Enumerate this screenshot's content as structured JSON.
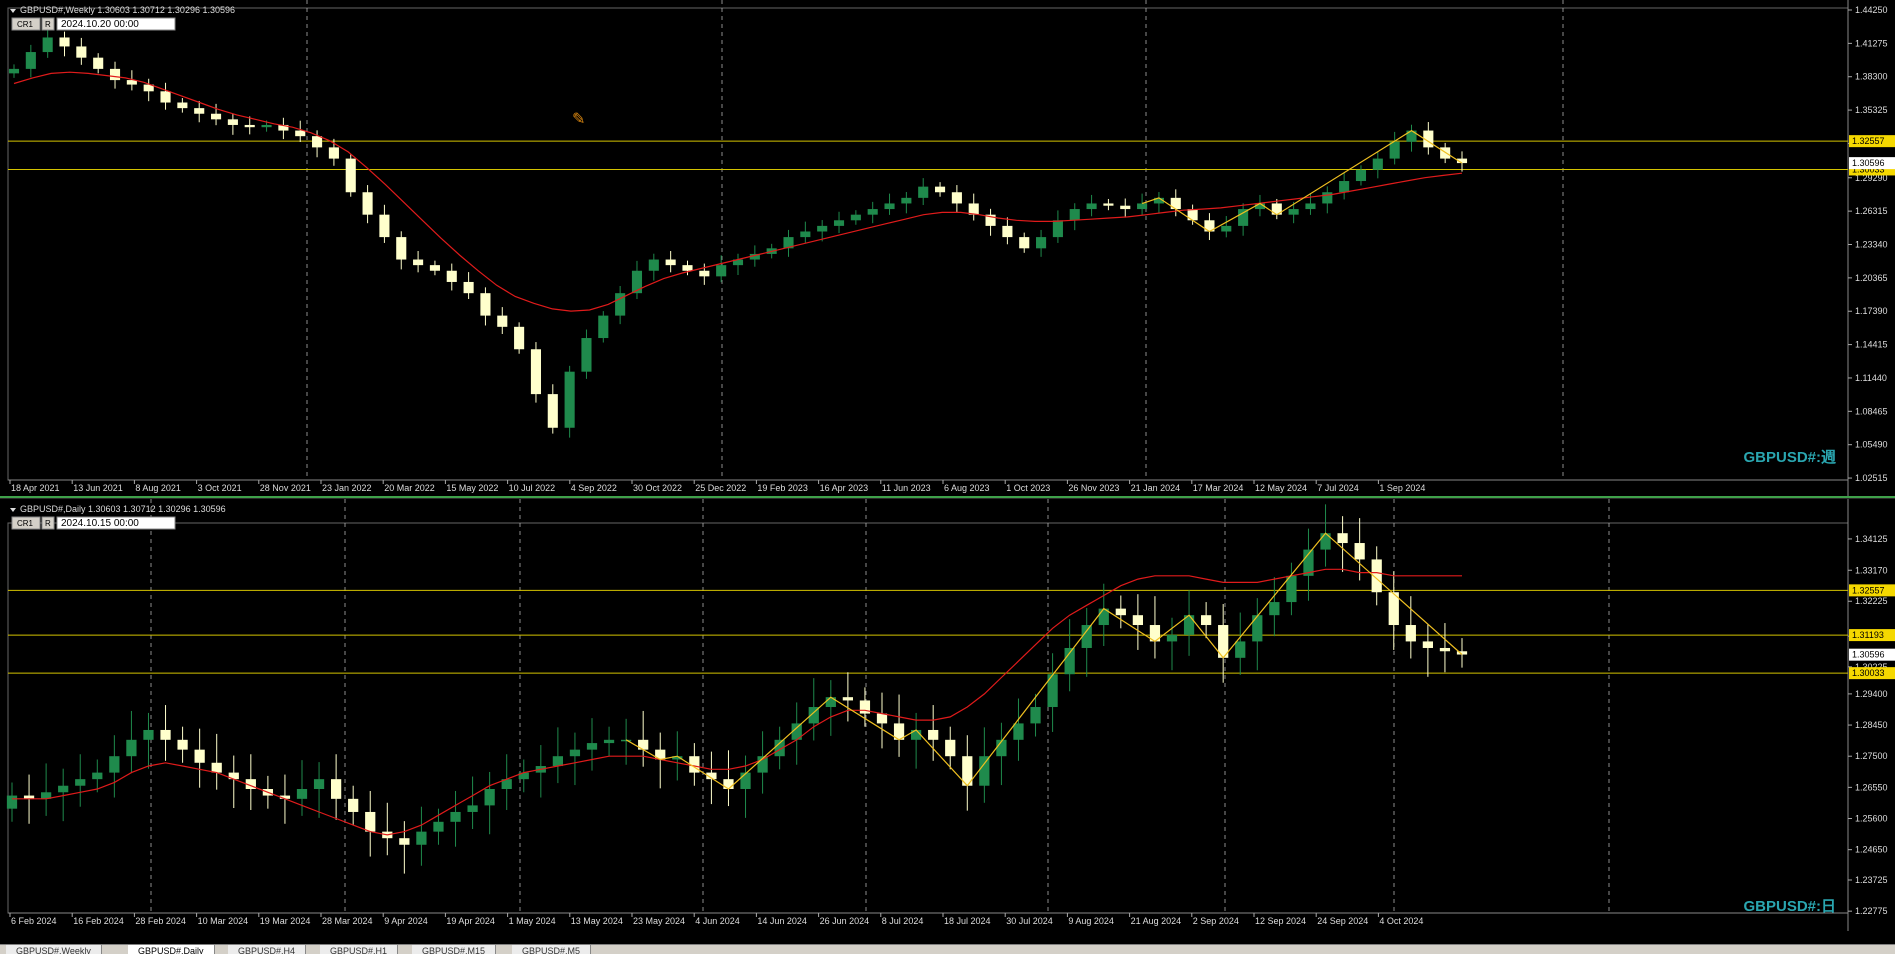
{
  "colors": {
    "background": "#000000",
    "bull_candle": "#1f8a4c",
    "bear_candle": "#ffffcc",
    "moving_average": "#e01b1b",
    "zigzag": "#f0c020",
    "level_line": "#d4c300",
    "price_label_bg": "#f5d800",
    "dashed_level": "#1e7a2a",
    "chart_label": "#2aa6b0",
    "grid": "#c8c8c8"
  },
  "weekly": {
    "header": "GBPUSD#,Weekly  1.30603 1.30712 1.30296 1.30596",
    "cr1": "CR1",
    "r": "R",
    "date_box": "2024.10.20  00:00",
    "label": "GBPUSD#:週",
    "cursor_icon": "crosshair-pencil-icon"
  },
  "daily": {
    "header": "GBPUSD#,Daily  1.30603 1.30712 1.30296 1.30596",
    "cr1": "CR1",
    "r": "R",
    "date_box": "2024.10.15  00:00",
    "label": "GBPUSD#:日"
  },
  "tabs": [
    "GBPUSD#,Weekly",
    "GBPUSD#,Daily",
    "GBPUSD#,H4",
    "GBPUSD#,H1",
    "GBPUSD#,M15",
    "GBPUSD#,M5"
  ],
  "chart_data": [
    {
      "type": "line",
      "title": "GBPUSD#,Weekly",
      "x_tick_labels": [
        "18 Apr 2021",
        "13 Jun 2021",
        "8 Aug 2021",
        "3 Oct 2021",
        "28 Nov 2021",
        "23 Jan 2022",
        "20 Mar 2022",
        "15 May 2022",
        "10 Jul 2022",
        "4 Sep 2022",
        "30 Oct 2022",
        "25 Dec 2022",
        "19 Feb 2023",
        "16 Apr 2023",
        "11 Jun 2023",
        "6 Aug 2023",
        "1 Oct 2023",
        "26 Nov 2023",
        "21 Jan 2024",
        "17 Mar 2024",
        "12 May 2024",
        "7 Jul 2024",
        "1 Sep 2024"
      ],
      "y_tick_labels": [
        "1.44250",
        "1.41275",
        "1.38300",
        "1.35325",
        "1.32350",
        "1.29290",
        "1.26315",
        "1.23340",
        "1.20365",
        "1.17390",
        "1.14415",
        "1.11440",
        "1.08465",
        "1.05490",
        "1.02515"
      ],
      "ylim": [
        1.0252,
        1.4425
      ],
      "price_levels": [
        "1.32557",
        "1.30033"
      ],
      "current_price": "1.30596",
      "series": [
        {
          "values": [
            1.39,
            1.405,
            1.418,
            1.41,
            1.4,
            1.39,
            1.38,
            1.376,
            1.37,
            1.36,
            1.355,
            1.35,
            1.345,
            1.34,
            1.338,
            1.34,
            1.335,
            1.33,
            1.32,
            1.31,
            1.28,
            1.26,
            1.24,
            1.22,
            1.215,
            1.21,
            1.2,
            1.19,
            1.17,
            1.16,
            1.14,
            1.1,
            1.07,
            1.12,
            1.15,
            1.17,
            1.19,
            1.21,
            1.22,
            1.215,
            1.21,
            1.205,
            1.215,
            1.22,
            1.225,
            1.23,
            1.24,
            1.245,
            1.25,
            1.255,
            1.26,
            1.265,
            1.27,
            1.275,
            1.285,
            1.28,
            1.27,
            1.26,
            1.25,
            1.24,
            1.23,
            1.24,
            1.255,
            1.265,
            1.27,
            1.268,
            1.265,
            1.27,
            1.275,
            1.265,
            1.255,
            1.245,
            1.25,
            1.265,
            1.27,
            1.26,
            1.265,
            1.27,
            1.28,
            1.29,
            1.3,
            1.31,
            1.325,
            1.335,
            1.32,
            1.31,
            1.306
          ]
        },
        {
          "values": [
            1.377,
            1.382,
            1.386,
            1.387,
            1.386,
            1.384,
            1.382,
            1.378,
            1.372,
            1.366,
            1.36,
            1.354,
            1.349,
            1.345,
            1.341,
            1.338,
            1.333,
            1.326,
            1.316,
            1.302,
            1.287,
            1.271,
            1.255,
            1.239,
            1.224,
            1.21,
            1.197,
            1.187,
            1.181,
            1.176,
            1.174,
            1.175,
            1.18,
            1.188,
            1.196,
            1.203,
            1.208,
            1.212,
            1.216,
            1.22,
            1.224,
            1.228,
            1.232,
            1.236,
            1.24,
            1.244,
            1.248,
            1.252,
            1.256,
            1.26,
            1.262,
            1.262,
            1.26,
            1.257,
            1.255,
            1.254,
            1.254,
            1.255,
            1.256,
            1.257,
            1.258,
            1.26,
            1.262,
            1.264,
            1.265,
            1.266,
            1.268,
            1.27,
            1.272,
            1.274,
            1.276,
            1.278,
            1.281,
            1.284,
            1.287,
            1.29,
            1.293,
            1.295,
            1.297
          ]
        }
      ]
    },
    {
      "type": "line",
      "title": "GBPUSD#,Daily",
      "x_tick_labels": [
        "6 Feb 2024",
        "16 Feb 2024",
        "28 Feb 2024",
        "10 Mar 2024",
        "19 Mar 2024",
        "28 Mar 2024",
        "9 Apr 2024",
        "19 Apr 2024",
        "1 May 2024",
        "13 May 2024",
        "23 May 2024",
        "4 Jun 2024",
        "14 Jun 2024",
        "26 Jun 2024",
        "8 Jul 2024",
        "18 Jul 2024",
        "30 Jul 2024",
        "9 Aug 2024",
        "21 Aug 2024",
        "2 Sep 2024",
        "12 Sep 2024",
        "24 Sep 2024",
        "4 Oct 2024"
      ],
      "y_tick_labels": [
        "1.34125",
        "1.33170",
        "1.32225",
        "1.31160",
        "1.30225",
        "1.29400",
        "1.28450",
        "1.27500",
        "1.26550",
        "1.25600",
        "1.24650",
        "1.23725",
        "1.22775"
      ],
      "ylim": [
        1.2278,
        1.3455
      ],
      "price_levels": [
        "1.32557",
        "1.31193",
        "1.30033"
      ],
      "current_price": "1.30596",
      "series": [
        {
          "values": [
            1.263,
            1.262,
            1.264,
            1.266,
            1.268,
            1.27,
            1.275,
            1.28,
            1.283,
            1.28,
            1.277,
            1.273,
            1.27,
            1.268,
            1.265,
            1.263,
            1.262,
            1.265,
            1.268,
            1.262,
            1.258,
            1.252,
            1.25,
            1.248,
            1.252,
            1.255,
            1.258,
            1.26,
            1.265,
            1.268,
            1.27,
            1.272,
            1.275,
            1.277,
            1.279,
            1.28,
            1.28,
            1.277,
            1.274,
            1.275,
            1.27,
            1.268,
            1.265,
            1.27,
            1.275,
            1.28,
            1.285,
            1.29,
            1.293,
            1.292,
            1.288,
            1.285,
            1.28,
            1.283,
            1.28,
            1.275,
            1.266,
            1.275,
            1.28,
            1.285,
            1.29,
            1.3,
            1.308,
            1.315,
            1.32,
            1.318,
            1.315,
            1.31,
            1.312,
            1.318,
            1.315,
            1.305,
            1.31,
            1.318,
            1.322,
            1.33,
            1.338,
            1.343,
            1.34,
            1.335,
            1.325,
            1.315,
            1.31,
            1.308,
            1.307,
            1.306
          ]
        },
        {
          "values": [
            1.262,
            1.262,
            1.262,
            1.263,
            1.264,
            1.265,
            1.267,
            1.27,
            1.272,
            1.273,
            1.272,
            1.271,
            1.27,
            1.268,
            1.266,
            1.264,
            1.262,
            1.26,
            1.258,
            1.256,
            1.254,
            1.252,
            1.251,
            1.252,
            1.254,
            1.257,
            1.26,
            1.263,
            1.266,
            1.268,
            1.27,
            1.271,
            1.272,
            1.273,
            1.274,
            1.275,
            1.275,
            1.275,
            1.274,
            1.273,
            1.272,
            1.271,
            1.271,
            1.272,
            1.274,
            1.277,
            1.28,
            1.284,
            1.287,
            1.289,
            1.289,
            1.288,
            1.287,
            1.286,
            1.286,
            1.287,
            1.29,
            1.294,
            1.299,
            1.304,
            1.309,
            1.314,
            1.318,
            1.321,
            1.324,
            1.327,
            1.329,
            1.33,
            1.33,
            1.33,
            1.329,
            1.328,
            1.328,
            1.328,
            1.329,
            1.33,
            1.331,
            1.332,
            1.332,
            1.331,
            1.331,
            1.33,
            1.33,
            1.33,
            1.33,
            1.33
          ]
        }
      ]
    }
  ]
}
